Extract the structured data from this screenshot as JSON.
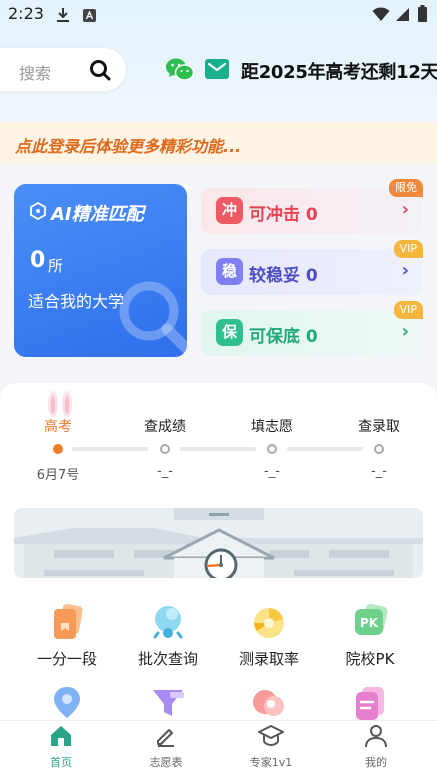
{
  "status_bar": {
    "time": "2:23"
  },
  "header": {
    "search_placeholder": "搜索",
    "countdown": "距2025年高考还剩12天"
  },
  "login_banner": {
    "text": "点此登录后体验更多精彩功能..."
  },
  "ai_card": {
    "title": "AI精准匹配",
    "count": "0",
    "unit": "所",
    "subtitle": "适合我的大学"
  },
  "levels": [
    {
      "badge": "冲",
      "label": "可冲击",
      "count": "0",
      "tag": "限免"
    },
    {
      "badge": "稳",
      "label": "较稳妥",
      "count": "0",
      "tag": "VIP"
    },
    {
      "badge": "保",
      "label": "可保底",
      "count": "0",
      "tag": "VIP"
    }
  ],
  "timeline": [
    {
      "label": "高考",
      "date": "6月7号"
    },
    {
      "label": "查成绩",
      "date": "-_-"
    },
    {
      "label": "填志愿",
      "date": "-_-"
    },
    {
      "label": "查录取",
      "date": "-_-"
    }
  ],
  "tools": [
    {
      "label": "一分一段",
      "icon": "rank-card-icon"
    },
    {
      "label": "批次查询",
      "icon": "batch-query-icon"
    },
    {
      "label": "测录取率",
      "icon": "admission-rate-icon"
    },
    {
      "label": "院校PK",
      "icon": "school-pk-icon",
      "icon_text": "PK"
    }
  ],
  "tools_row2_icons": [
    "location-icon",
    "filter-icon",
    "palette-icon",
    "document-icon"
  ],
  "bottom_nav": [
    {
      "label": "首页",
      "icon": "home-icon",
      "active": true
    },
    {
      "label": "志愿表",
      "icon": "edit-icon",
      "active": false
    },
    {
      "label": "专家1v1",
      "icon": "graduation-cap-icon",
      "active": false
    },
    {
      "label": "我的",
      "icon": "user-icon",
      "active": false
    }
  ],
  "colors": {
    "accent_orange": "#f07a2a",
    "ai_blue": "#2f6fec",
    "rush_red": "#e24452",
    "stable_purple": "#4d4ec6",
    "safe_green": "#21a97b",
    "nav_active": "#2aa58a"
  }
}
